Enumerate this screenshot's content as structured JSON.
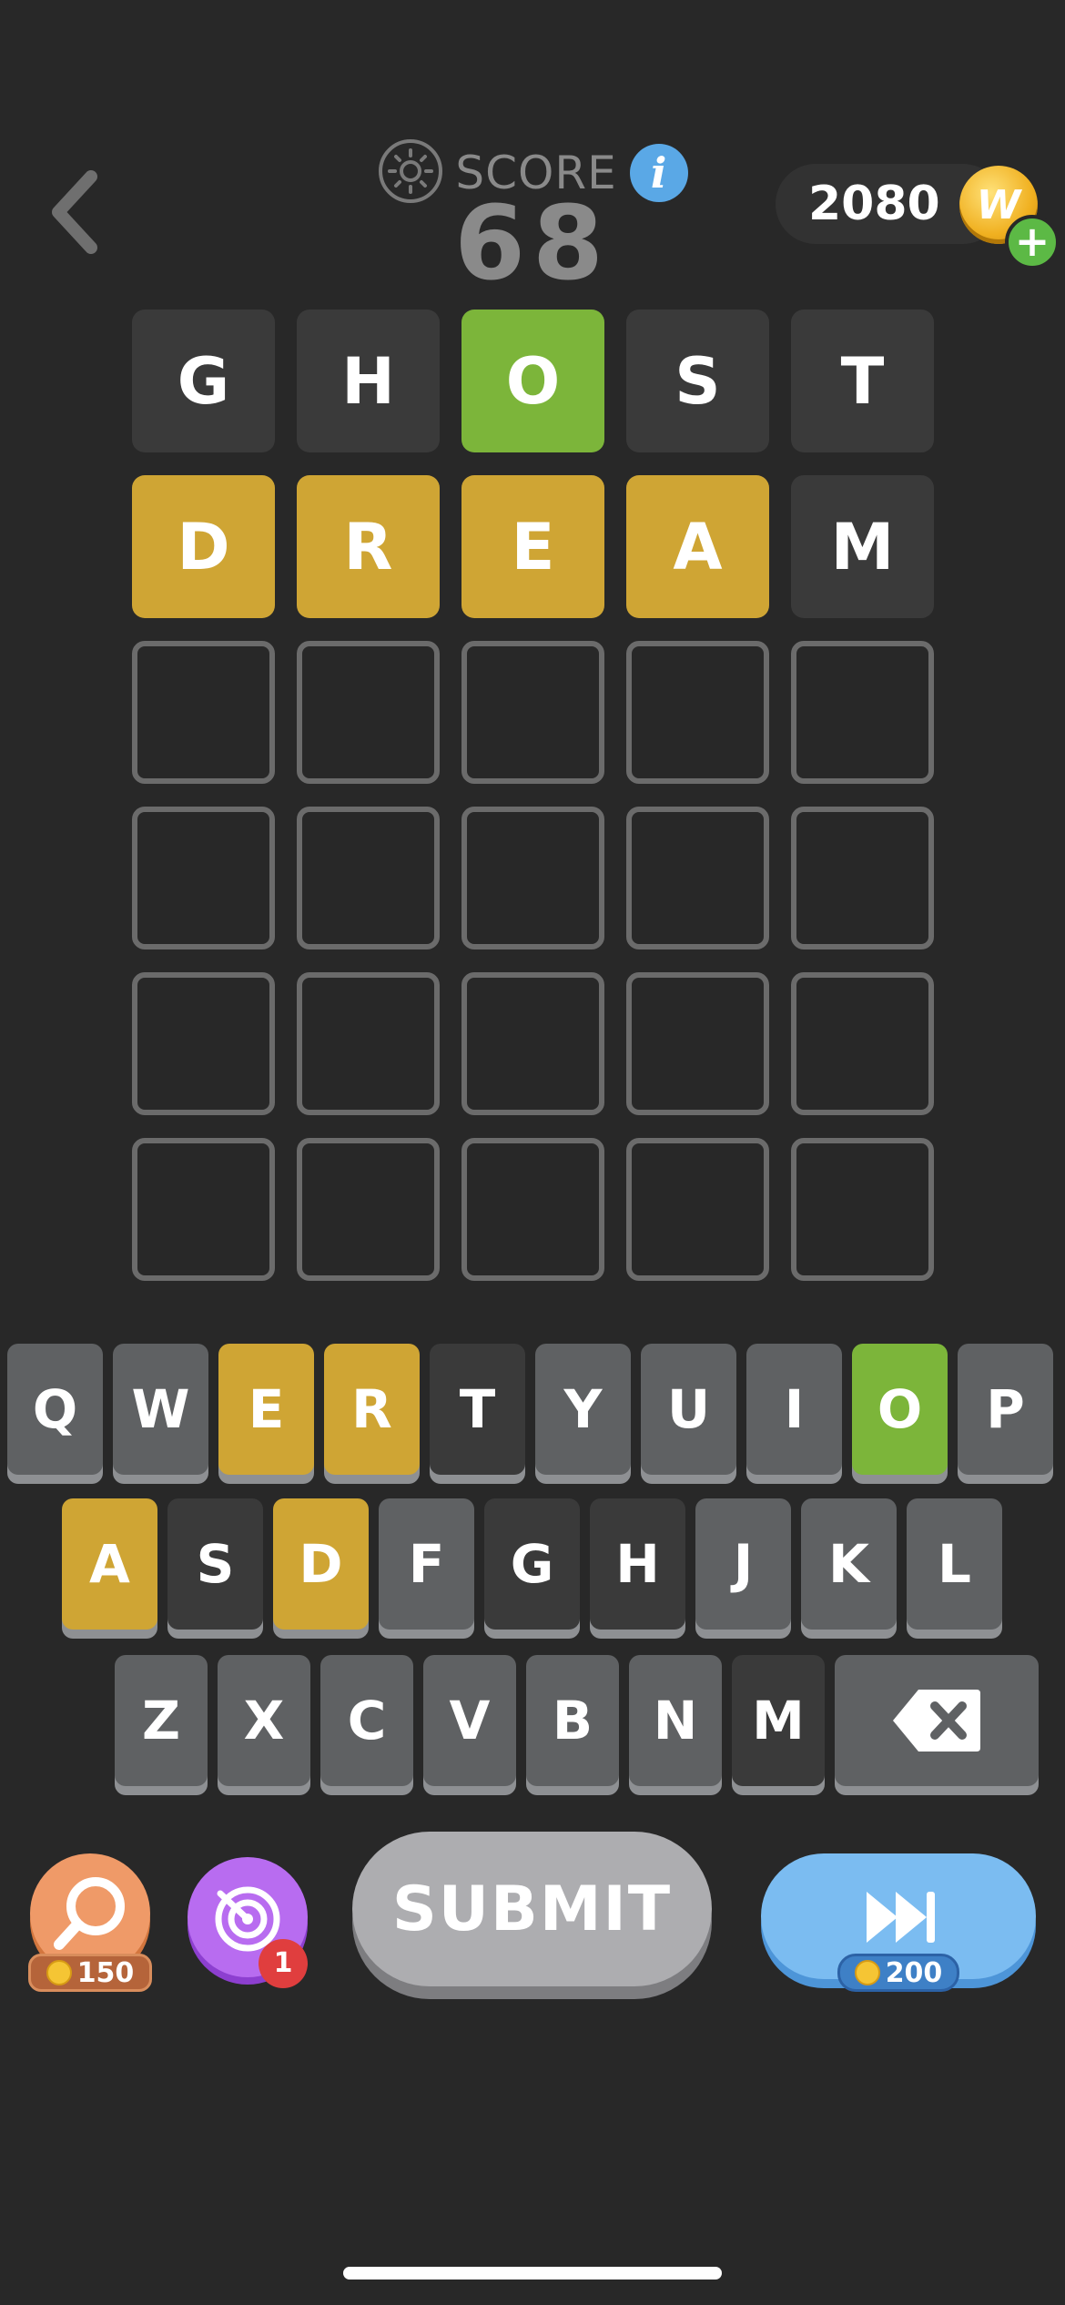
{
  "header": {
    "score_label": "SCORE",
    "score_value": "68",
    "coins": "2080",
    "coin_symbol": "W",
    "add_coins": "+"
  },
  "board": {
    "rows": [
      [
        {
          "letter": "G",
          "state": "absent"
        },
        {
          "letter": "H",
          "state": "absent"
        },
        {
          "letter": "O",
          "state": "correct"
        },
        {
          "letter": "S",
          "state": "absent"
        },
        {
          "letter": "T",
          "state": "absent"
        }
      ],
      [
        {
          "letter": "D",
          "state": "present"
        },
        {
          "letter": "R",
          "state": "present"
        },
        {
          "letter": "E",
          "state": "present"
        },
        {
          "letter": "A",
          "state": "present"
        },
        {
          "letter": "M",
          "state": "absent"
        }
      ],
      [
        {
          "letter": "",
          "state": "empty"
        },
        {
          "letter": "",
          "state": "empty"
        },
        {
          "letter": "",
          "state": "empty"
        },
        {
          "letter": "",
          "state": "empty"
        },
        {
          "letter": "",
          "state": "empty"
        }
      ],
      [
        {
          "letter": "",
          "state": "empty"
        },
        {
          "letter": "",
          "state": "empty"
        },
        {
          "letter": "",
          "state": "empty"
        },
        {
          "letter": "",
          "state": "empty"
        },
        {
          "letter": "",
          "state": "empty"
        }
      ],
      [
        {
          "letter": "",
          "state": "empty"
        },
        {
          "letter": "",
          "state": "empty"
        },
        {
          "letter": "",
          "state": "empty"
        },
        {
          "letter": "",
          "state": "empty"
        },
        {
          "letter": "",
          "state": "empty"
        }
      ],
      [
        {
          "letter": "",
          "state": "empty"
        },
        {
          "letter": "",
          "state": "empty"
        },
        {
          "letter": "",
          "state": "empty"
        },
        {
          "letter": "",
          "state": "empty"
        },
        {
          "letter": "",
          "state": "empty"
        }
      ]
    ]
  },
  "keyboard": {
    "rows": [
      [
        {
          "key": "Q",
          "state": "unused"
        },
        {
          "key": "W",
          "state": "unused"
        },
        {
          "key": "E",
          "state": "present"
        },
        {
          "key": "R",
          "state": "present"
        },
        {
          "key": "T",
          "state": "absent"
        },
        {
          "key": "Y",
          "state": "unused"
        },
        {
          "key": "U",
          "state": "unused"
        },
        {
          "key": "I",
          "state": "unused"
        },
        {
          "key": "O",
          "state": "correct"
        },
        {
          "key": "P",
          "state": "unused"
        }
      ],
      [
        {
          "key": "A",
          "state": "present"
        },
        {
          "key": "S",
          "state": "absent"
        },
        {
          "key": "D",
          "state": "present"
        },
        {
          "key": "F",
          "state": "unused"
        },
        {
          "key": "G",
          "state": "absent"
        },
        {
          "key": "H",
          "state": "absent"
        },
        {
          "key": "J",
          "state": "unused"
        },
        {
          "key": "K",
          "state": "unused"
        },
        {
          "key": "L",
          "state": "unused"
        }
      ],
      [
        {
          "key": "Z",
          "state": "unused"
        },
        {
          "key": "X",
          "state": "unused"
        },
        {
          "key": "C",
          "state": "unused"
        },
        {
          "key": "V",
          "state": "unused"
        },
        {
          "key": "B",
          "state": "unused"
        },
        {
          "key": "N",
          "state": "unused"
        },
        {
          "key": "M",
          "state": "absent"
        }
      ]
    ],
    "backspace_icon": "backspace-icon"
  },
  "actions": {
    "hint_price": "150",
    "target_badge": "1",
    "submit_label": "SUBMIT",
    "skip_price": "200"
  },
  "colors": {
    "background": "#282828",
    "correct": "#7cb53a",
    "present": "#cfa534",
    "absent": "#3a3a3a",
    "unused_key": "#5f6163"
  }
}
